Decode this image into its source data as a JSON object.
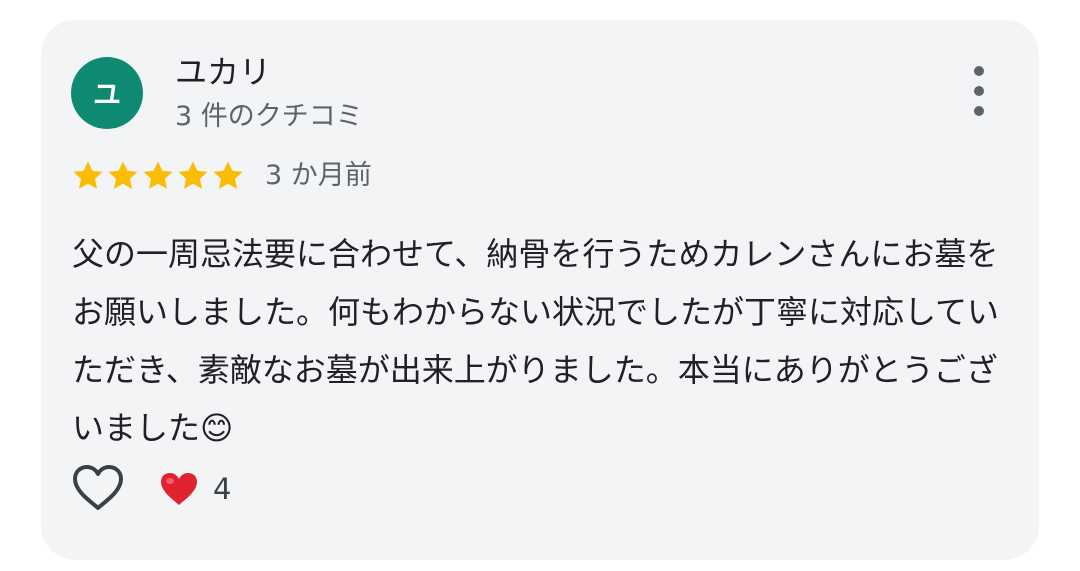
{
  "review": {
    "avatar_letter": "ユ",
    "avatar_color": "#0f8a72",
    "reviewer_name": "ユカリ",
    "reviewer_review_count": "3 件のクチコミ",
    "rating": 5,
    "rating_max": 5,
    "star_color": "#fbbc04",
    "date": "3 か月前",
    "text": "父の一周忌法要に合わせて、納骨を行うためカレンさんにお墓をお願いしました。何もわからない状況でしたが丁寧に対応していただき、素敵なお墓が出来上がりました。本当にありがとうございました😊",
    "more_icon": "more-vert-icon",
    "like_icon": "heart-outline-icon",
    "reaction_icon": "red-heart-icon",
    "reaction_count": "4"
  }
}
